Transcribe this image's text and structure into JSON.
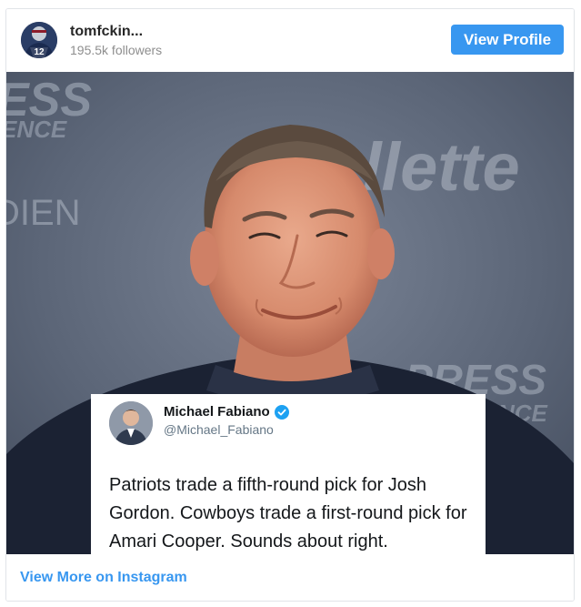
{
  "header": {
    "username": "tomfckin...",
    "followers": "195.5k followers",
    "view_profile_label": "View Profile",
    "avatar_jersey_number": "12"
  },
  "media": {
    "background_text_top": "ESS",
    "background_text_top2": "ENCE",
    "background_text_left": "DIEN",
    "background_text_brand": "llette",
    "background_text_right": "PRESS",
    "background_text_right2": "NCE",
    "tweet": {
      "name": "Michael Fabiano",
      "handle": "@Michael_Fabiano",
      "text": "Patriots trade a fifth-round pick for Josh Gordon. Cowboys trade a first-round pick for Amari Cooper. Sounds about right."
    }
  },
  "footer": {
    "view_more_label": "View More on Instagram"
  },
  "colors": {
    "accent": "#3897f0",
    "verified": "#1da1f2"
  }
}
